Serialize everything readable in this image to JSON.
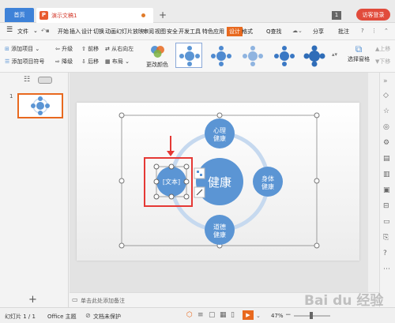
{
  "titlebar": {
    "home_tab": "首页",
    "doc_tab": "演示文稿1",
    "doc_icon": "P",
    "add_tab": "+",
    "window_count": "1",
    "visitor_login": "访客登录"
  },
  "menubar": {
    "file": "文件",
    "items": [
      "开始",
      "插入",
      "设计",
      "切换",
      "动画",
      "幻灯片放映",
      "审阅",
      "视图",
      "安全",
      "开发工具",
      "特色应用",
      "设计",
      "格式"
    ],
    "search": "Q查找",
    "share": "分享",
    "comment": "批注"
  },
  "toolbar": {
    "add_item": "添加项目",
    "add_item_sibling": "添加项目符号",
    "upgrade": "升级",
    "downgrade": "降级",
    "move_forward": "前移",
    "move_backward": "后移",
    "right_to_left": "从右向左",
    "layout": "布局",
    "change_color": "更改颜色",
    "select_pane": "选择窗格",
    "up": "上移",
    "down": "下移"
  },
  "smartart": {
    "center": "健康",
    "top": "心理\n健康",
    "right": "身体\n健康",
    "bottom": "道德\n健康",
    "left": "[文本]"
  },
  "notes": {
    "placeholder": "单击此处添加备注"
  },
  "statusbar": {
    "slide_info": "幻灯片 1 / 1",
    "theme": "Office 主题",
    "protect": "文档未保护",
    "zoom": "47%"
  },
  "slide_number": "1",
  "watermark": "Bai du 经验",
  "colors": {
    "accent": "#e8691f",
    "circle_blue": "#5b95d4",
    "home_tab": "#3e82d8",
    "visitor": "#e14b3b",
    "highlight": "#e53935"
  }
}
